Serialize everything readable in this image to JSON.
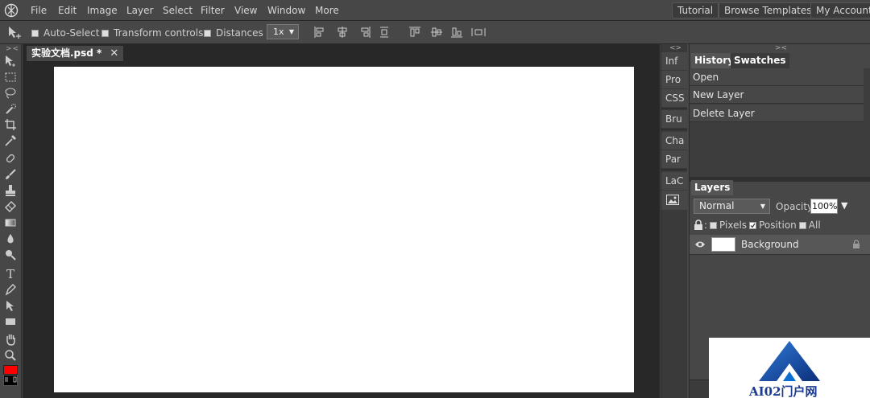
{
  "app": {
    "menu": [
      "File",
      "Edit",
      "Image",
      "Layer",
      "Select",
      "Filter",
      "View",
      "Window",
      "More"
    ],
    "top_buttons": [
      "Tutorial",
      "Browse Templates",
      "My Account"
    ]
  },
  "options_bar": {
    "auto_select": "Auto-Select",
    "transform_controls": "Transform controls",
    "distances": "Distances",
    "zoom": "1x"
  },
  "document": {
    "tab_title": "实验文档.psd *",
    "close": "✕"
  },
  "mini_panel": {
    "items": [
      "Inf",
      "Pro",
      "CSS",
      "Bru",
      "Cha",
      "Par",
      "LaC"
    ]
  },
  "history_panel": {
    "tabs": [
      "History",
      "Swatches"
    ],
    "items": [
      "Open",
      "New Layer",
      "Delete Layer"
    ]
  },
  "layers_panel": {
    "tab": "Layers",
    "blend_mode": "Normal",
    "opacity_label": "Opacity:",
    "opacity_value": "100%",
    "lock_pixels": "Pixels",
    "lock_position": "Position",
    "lock_all": "All",
    "layer_name": "Background"
  },
  "colors": {
    "foreground": "#ff0000",
    "background": "#000000",
    "panel_bg": "#474747",
    "workspace_bg": "#282828"
  },
  "watermark": {
    "text": "AI02门户网"
  }
}
